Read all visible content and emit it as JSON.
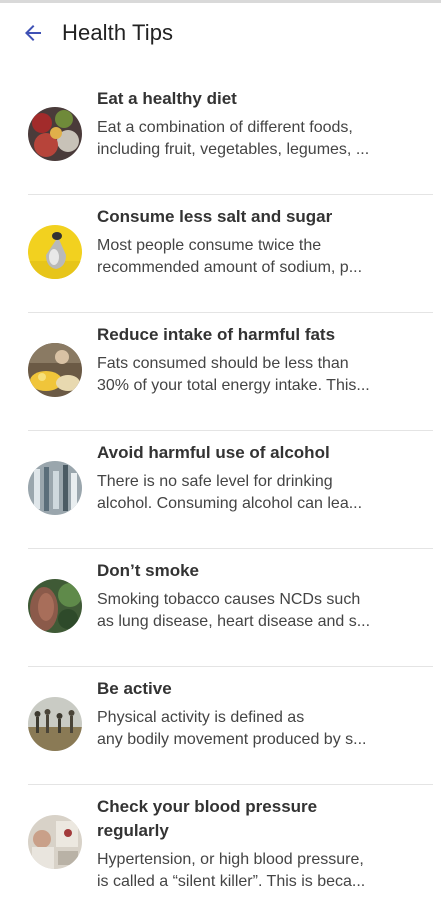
{
  "header": {
    "back_icon": "arrow-left-icon",
    "title": "Health Tips",
    "accent": "#3f51b5"
  },
  "tips": [
    {
      "title": "Eat a healthy diet",
      "description": "Eat a combination of different foods,\nincluding fruit, vegetables, legumes, ...",
      "image": "healthy-food-image"
    },
    {
      "title": "Consume less salt and sugar",
      "description": "Most people consume twice the\nrecommended amount of sodium, p...",
      "image": "salt-shaker-image"
    },
    {
      "title": "Reduce intake of harmful fats",
      "description": "Fats consumed should be less than\n30% of your total energy intake. This...",
      "image": "fatty-food-image"
    },
    {
      "title": "Avoid harmful use of alcohol",
      "description": "There is no safe level for drinking\nalcohol. Consuming alcohol can lea...",
      "image": "alcohol-image"
    },
    {
      "title": "Don’t smoke",
      "description": "Smoking tobacco causes NCDs such\nas lung disease, heart disease and s...",
      "image": "smoking-image"
    },
    {
      "title": "Be active",
      "description": "Physical activity is defined as\nany bodily movement produced by s...",
      "image": "exercise-image"
    },
    {
      "title": "Check your blood pressure\nregularly",
      "description": "Hypertension, or high blood pressure,\nis called a “silent killer”. This is beca...",
      "image": "blood-pressure-image"
    }
  ]
}
